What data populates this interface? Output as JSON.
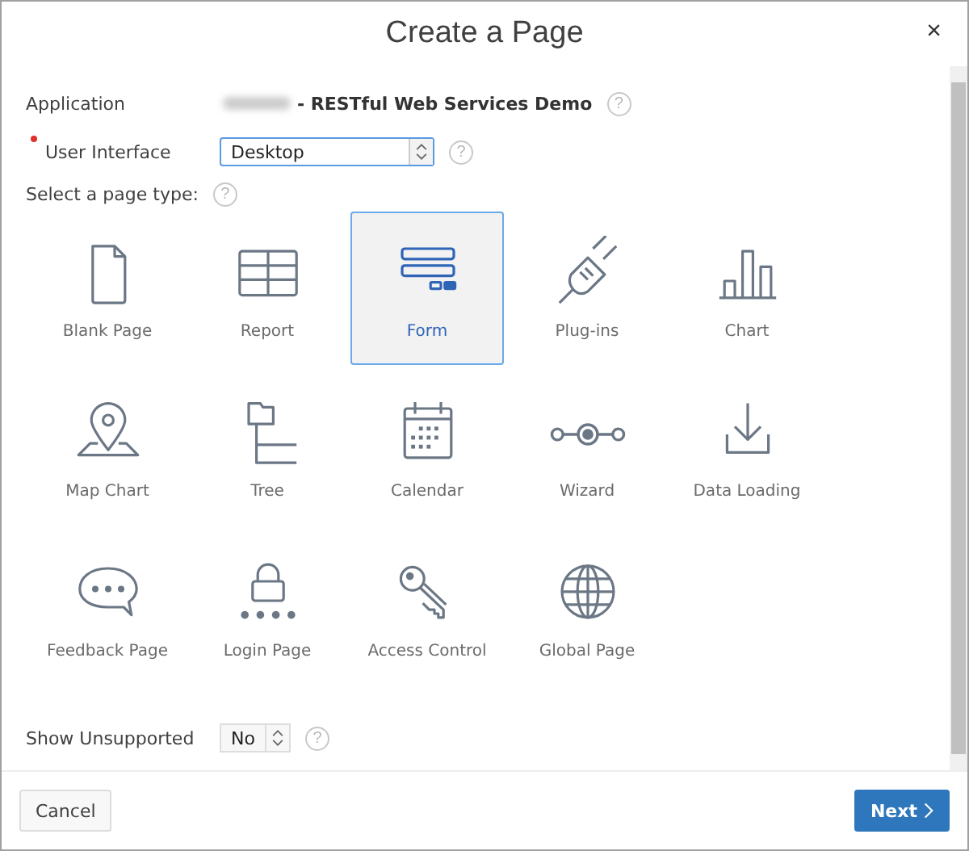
{
  "dialog": {
    "title": "Create a Page",
    "close": "×"
  },
  "fields": {
    "application_label": "Application",
    "application_value": "- RESTful Web Services Demo",
    "ui_label": "User Interface",
    "ui_required": true,
    "ui_value": "Desktop",
    "page_type_label": "Select a page type:",
    "application_help": "?",
    "ui_help": "?",
    "page_type_help": "?"
  },
  "page_types": [
    {
      "label": "Blank Page",
      "selected": false
    },
    {
      "label": "Report",
      "selected": false
    },
    {
      "label": "Form",
      "selected": true
    },
    {
      "label": "Plug-ins",
      "selected": false
    },
    {
      "label": "Chart",
      "selected": false
    },
    {
      "label": "Map Chart",
      "selected": false
    },
    {
      "label": "Tree",
      "selected": false
    },
    {
      "label": "Calendar",
      "selected": false
    },
    {
      "label": "Wizard",
      "selected": false
    },
    {
      "label": "Data Loading",
      "selected": false
    },
    {
      "label": "Feedback Page",
      "selected": false
    },
    {
      "label": "Login Page",
      "selected": false
    },
    {
      "label": "Access Control",
      "selected": false
    },
    {
      "label": "Global Page",
      "selected": false
    }
  ],
  "show_unsupported": {
    "label": "Show Unsupported",
    "value": "No",
    "help": "?"
  },
  "buttons": {
    "cancel": "Cancel",
    "next": "Next"
  }
}
